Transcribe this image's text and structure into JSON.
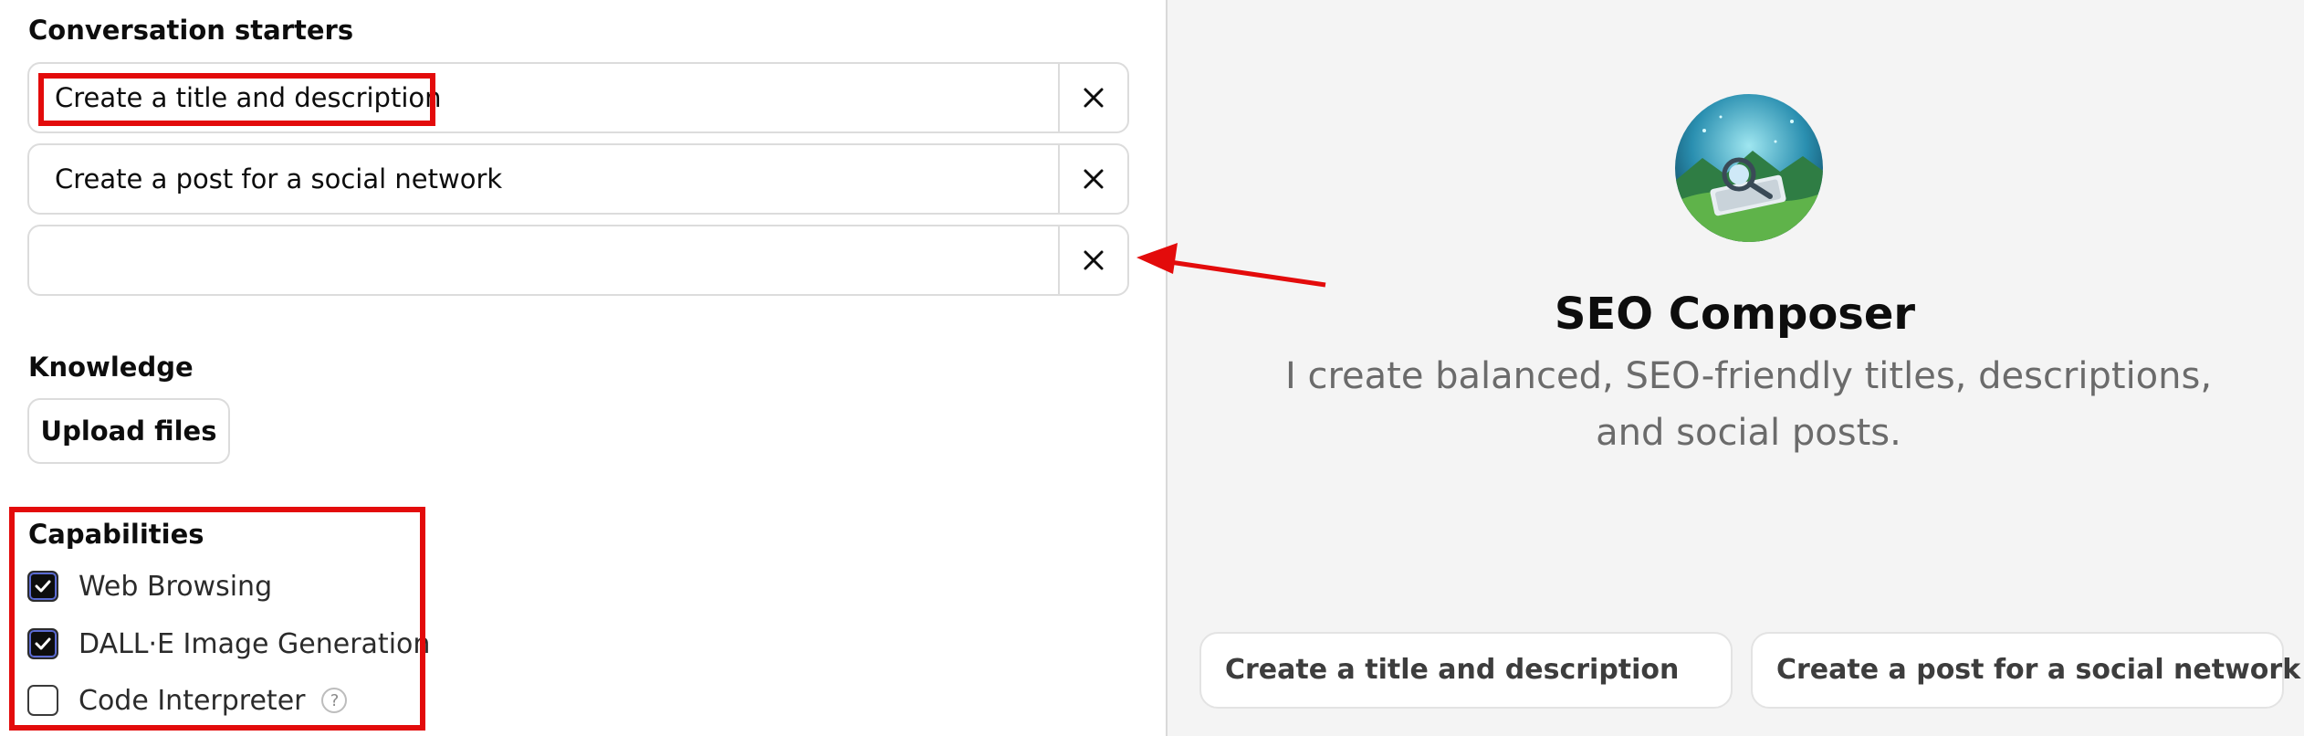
{
  "conversation_starters": {
    "label": "Conversation starters",
    "items": [
      {
        "value": "Create a title and description"
      },
      {
        "value": "Create a post for a social network"
      },
      {
        "value": ""
      }
    ]
  },
  "knowledge": {
    "label": "Knowledge",
    "upload_label": "Upload files"
  },
  "capabilities": {
    "label": "Capabilities",
    "items": [
      {
        "label": "Web Browsing",
        "checked": true
      },
      {
        "label": "DALL·E Image Generation",
        "checked": true
      },
      {
        "label": "Code Interpreter",
        "checked": false,
        "help": "?"
      }
    ]
  },
  "preview": {
    "avatar_icon": "gpt-avatar",
    "name": "SEO Composer",
    "description": "I create balanced, SEO-friendly titles, descriptions, and social posts.",
    "suggestions": [
      "Create a title and description",
      "Create a post for a social network"
    ]
  },
  "annotations": {
    "highlight_color": "#e30b0b"
  },
  "colors": {
    "preview_bg": "#f4f4f4",
    "checkbox_checked": "#0d0d0d",
    "checkbox_ring": "#5b6bd3"
  }
}
